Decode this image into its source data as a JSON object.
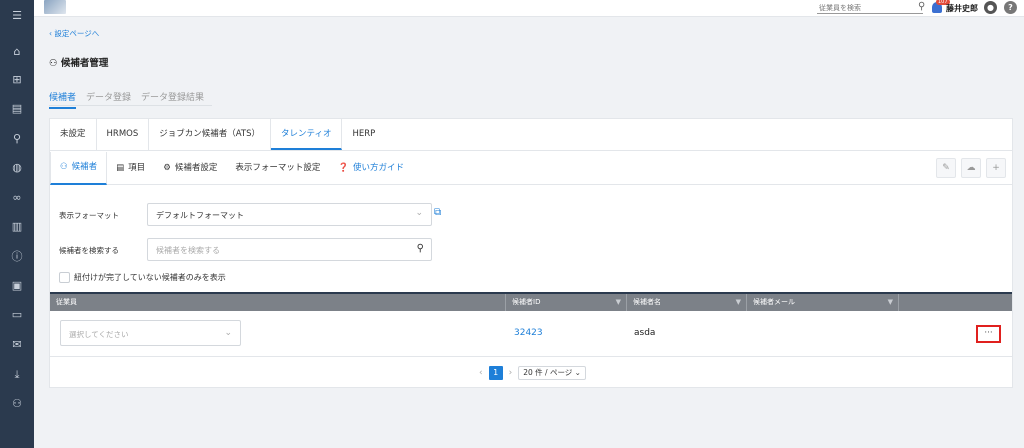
{
  "topbar": {
    "search_placeholder": "従業員を検索",
    "notification_count": "107",
    "user_name": "藤井史郎"
  },
  "nav": {
    "back_link": "設定ページへ",
    "page_title": "候補者管理"
  },
  "main_tabs": [
    {
      "label": "候補者",
      "active": true
    },
    {
      "label": "データ登録",
      "active": false
    },
    {
      "label": "データ登録結果",
      "active": false
    }
  ],
  "ats_tabs": [
    {
      "label": "未設定"
    },
    {
      "label": "HRMOS"
    },
    {
      "label": "ジョブカン候補者（ATS）"
    },
    {
      "label": "タレンティオ",
      "active": true
    },
    {
      "label": "HERP"
    }
  ],
  "sub_tabs": [
    {
      "label": "候補者",
      "icon": "person-icon",
      "active": true
    },
    {
      "label": "項目",
      "icon": "list-icon"
    },
    {
      "label": "候補者設定",
      "icon": "gear-icon"
    },
    {
      "label": "表示フォーマット設定"
    },
    {
      "label": "使い方ガイド",
      "icon": "help-circle-icon"
    }
  ],
  "form": {
    "format_label": "表示フォーマット",
    "format_value": "デフォルトフォーマット",
    "search_label": "候補者を検索する",
    "search_placeholder": "候補者を検索する",
    "checkbox_label": "紐付けが完了していない候補者のみを表示"
  },
  "table": {
    "headers": [
      "従業員",
      "候補者ID",
      "候補者名",
      "候補者メール"
    ],
    "rows": [
      {
        "employee_placeholder": "選択してください",
        "candidate_id": "32423",
        "candidate_name": "asda",
        "candidate_email": ""
      }
    ]
  },
  "pager": {
    "current_page": "1",
    "page_size": "20 件 / ページ"
  },
  "colors": {
    "accent": "#1e7fd8",
    "sidebar": "#2b3a4e",
    "highlight": "#e0201e"
  }
}
